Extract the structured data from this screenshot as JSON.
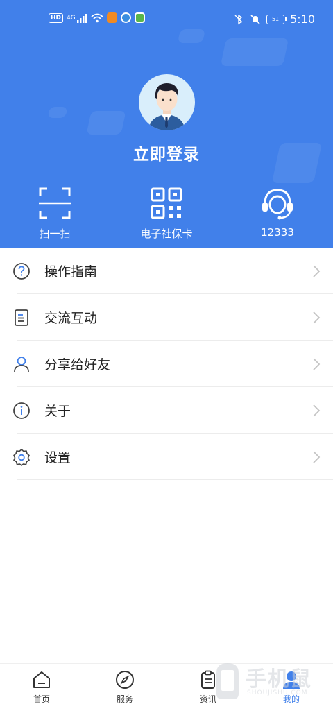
{
  "status_bar": {
    "network_tag": "HD",
    "signal": "4G",
    "time": "5:10",
    "battery": "51",
    "app_icons": [
      {
        "name": "video-app-icon",
        "color": "#f08a24"
      },
      {
        "name": "browser-app-icon",
        "color": "#3a8de0"
      },
      {
        "name": "chat-app-icon",
        "color": "#59b54a"
      }
    ]
  },
  "profile": {
    "login_label": "立即登录"
  },
  "quick_actions": [
    {
      "label": "扫一扫",
      "icon": "scan-icon"
    },
    {
      "label": "电子社保卡",
      "icon": "qr-code-icon"
    },
    {
      "label": "12333",
      "icon": "customer-service-icon"
    }
  ],
  "menu": [
    {
      "label": "操作指南",
      "icon": "help-icon"
    },
    {
      "label": "交流互动",
      "icon": "document-icon"
    },
    {
      "label": "分享给好友",
      "icon": "user-icon"
    },
    {
      "label": "关于",
      "icon": "info-icon"
    },
    {
      "label": "设置",
      "icon": "gear-icon"
    }
  ],
  "bottom_nav": [
    {
      "label": "首页",
      "icon": "home-icon"
    },
    {
      "label": "服务",
      "icon": "compass-icon"
    },
    {
      "label": "资讯",
      "icon": "clipboard-icon"
    },
    {
      "label": "我的",
      "icon": "profile-icon",
      "active": true
    }
  ],
  "colors": {
    "header_bg": "#4180ea",
    "accent": "#4180ea",
    "text_primary": "#222222",
    "divider": "#ececec"
  },
  "watermark": {
    "text": "手机鼠",
    "subtext": "SHOUJISHU.COM"
  }
}
